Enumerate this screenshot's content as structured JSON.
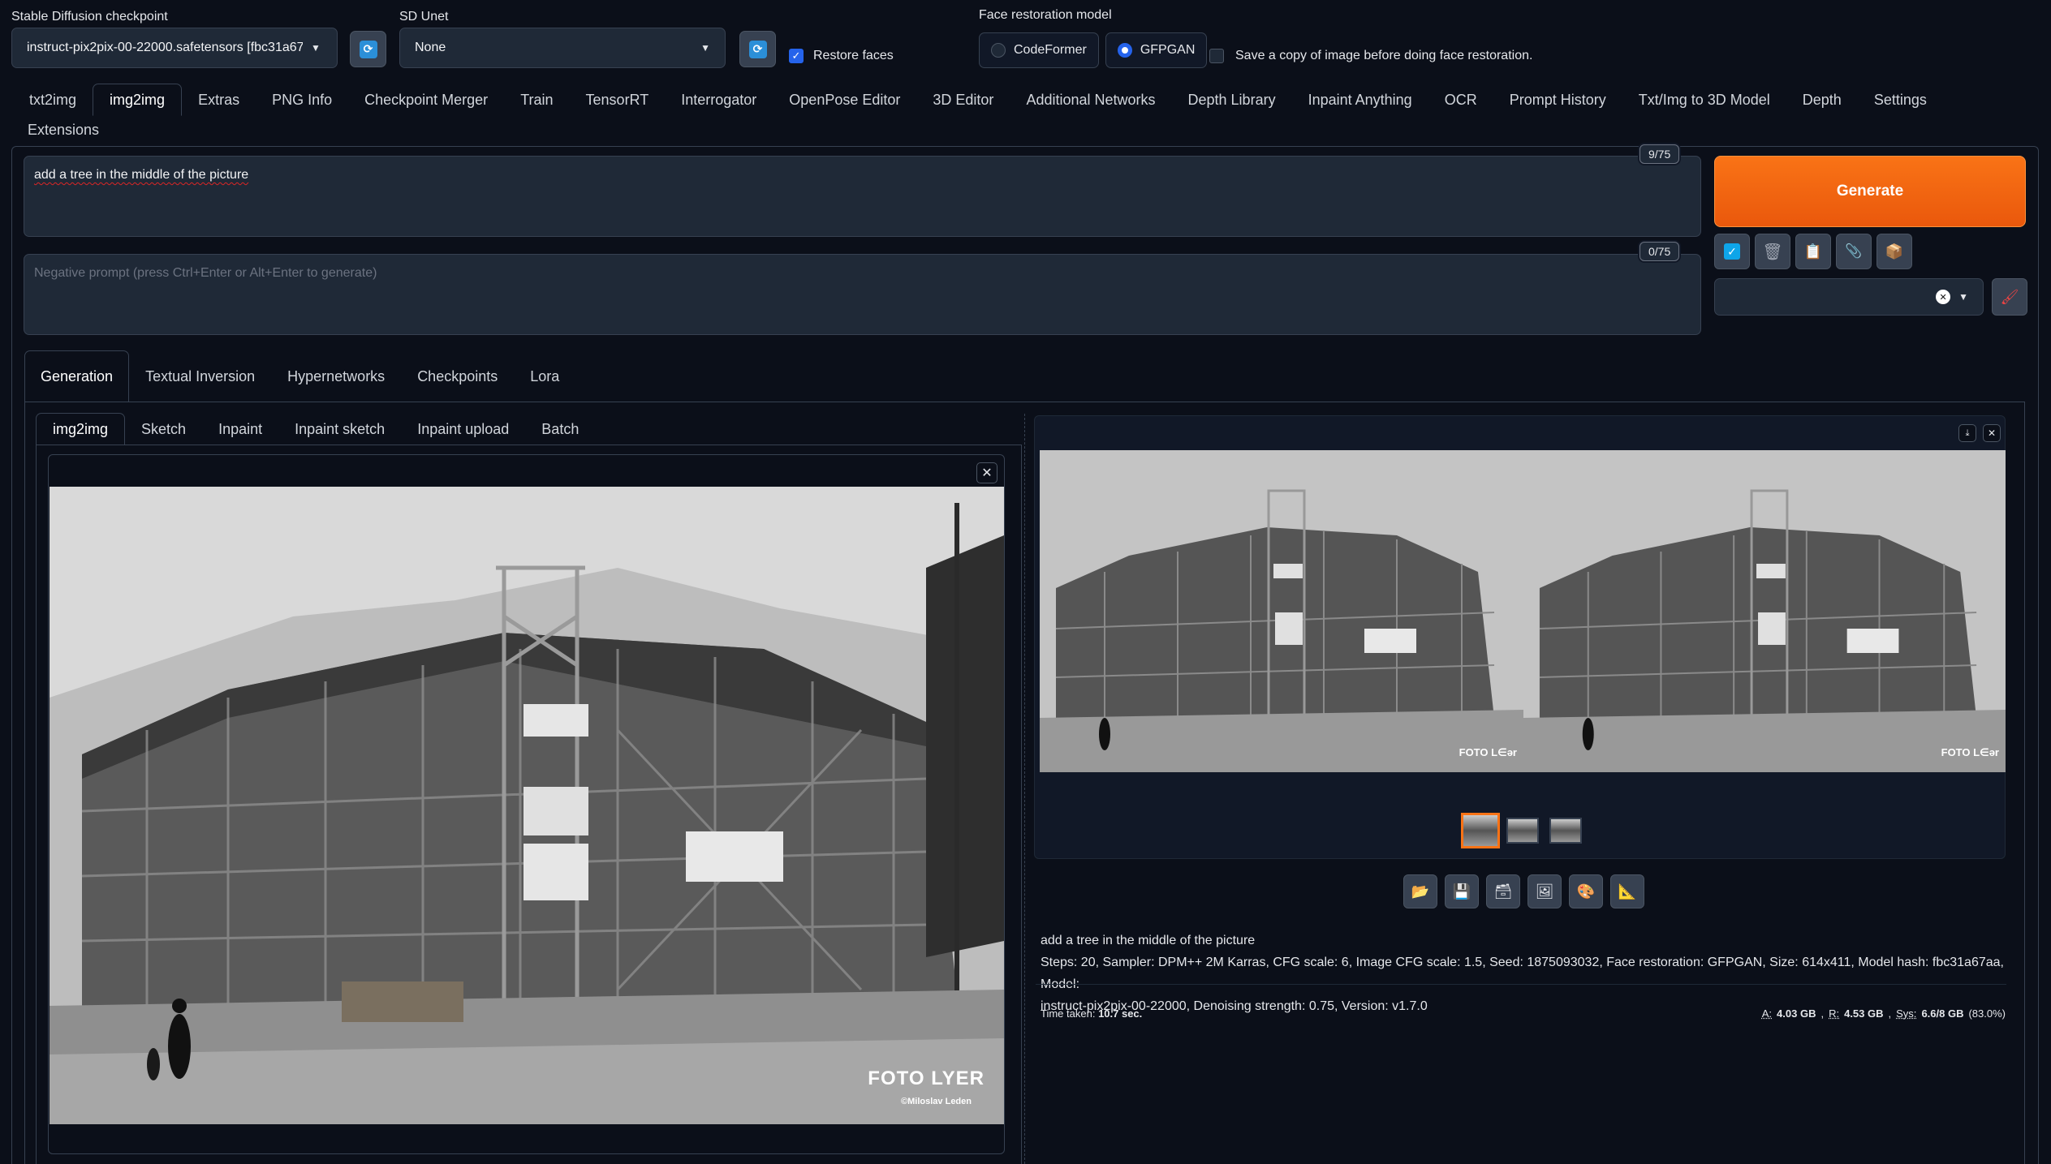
{
  "top": {
    "checkpoint_label": "Stable Diffusion checkpoint",
    "checkpoint_value": "instruct-pix2pix-00-22000.safetensors [fbc31a67",
    "unet_label": "SD Unet",
    "unet_value": "None",
    "restore_faces_label": "Restore faces",
    "face_restoration_label": "Face restoration model",
    "face_options": [
      "CodeFormer",
      "GFPGAN"
    ],
    "save_copy_label": "Save a copy of image before doing face restoration."
  },
  "main_tabs": [
    "txt2img",
    "img2img",
    "Extras",
    "PNG Info",
    "Checkpoint Merger",
    "Train",
    "TensorRT",
    "Interrogator",
    "OpenPose Editor",
    "3D Editor",
    "Additional Networks",
    "Depth Library",
    "Inpaint Anything",
    "OCR",
    "Prompt History",
    "Txt/Img to 3D Model",
    "Depth",
    "Settings"
  ],
  "main_tabs_row2": [
    "Extensions"
  ],
  "prompt": {
    "value": "add a tree in the middle of the picture",
    "counter": "9/75",
    "negative_placeholder": "Negative prompt (press Ctrl+Enter or Alt+Enter to generate)",
    "negative_counter": "0/75"
  },
  "generate_label": "Generate",
  "sub_tabs": [
    "Generation",
    "Textual Inversion",
    "Hypernetworks",
    "Checkpoints",
    "Lora"
  ],
  "mode_tabs": [
    "img2img",
    "Sketch",
    "Inpaint",
    "Inpaint sketch",
    "Inpaint upload",
    "Batch"
  ],
  "input_image": {
    "watermark_main": "FOTO LYER",
    "watermark_sub": "©Miloslav Leden"
  },
  "output": {
    "prompt_line": "add a tree in the middle of the picture",
    "params_line1": "Steps: 20, Sampler: DPM++ 2M Karras, CFG scale: 6, Image CFG scale: 1.5, Seed: 1875093032, Face restoration: GFPGAN, Size: 614x411, Model hash: fbc31a67aa, Model:",
    "params_line2": "instruct-pix2pix-00-22000, Denoising strength: 0.75, Version: v1.7.0",
    "time_label": "Time taken:",
    "time_value": "10.7 sec.",
    "mem_a_label": "A:",
    "mem_a": "4.03 GB",
    "mem_r_label": "R:",
    "mem_r": "4.53 GB",
    "mem_sys_label": "Sys:",
    "mem_sys": "6.6/8 GB",
    "mem_pct": "(83.0%)",
    "watermark": "FOTO L∈ər"
  },
  "colors": {
    "accent": "#f97316",
    "background": "#0b0f19",
    "panel": "#1f2937",
    "checkbox_on": "#2563eb"
  }
}
